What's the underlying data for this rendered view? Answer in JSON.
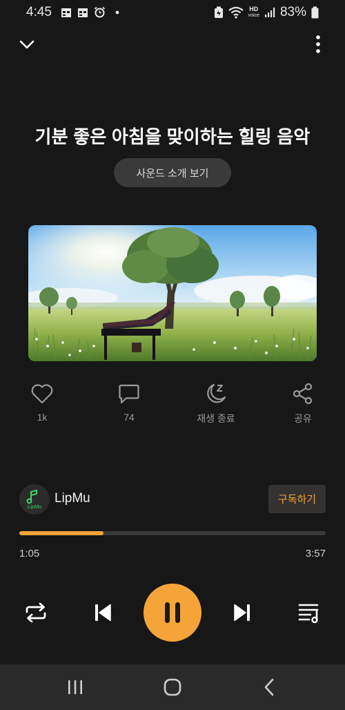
{
  "status_bar": {
    "time": "4:45",
    "battery": "83%",
    "hd_line1": "HD",
    "hd_line2": "voice",
    "icons": [
      "calendar-icon",
      "calendar-icon",
      "alarm-icon",
      "dot-icon",
      "battery-saver-icon",
      "wifi-icon",
      "signal-icon",
      "battery-icon"
    ]
  },
  "header": {
    "collapse_icon": "chevron-down-icon",
    "more_icon": "more-vertical-icon"
  },
  "track": {
    "title": "기분 좋은 아침을 맞이하는 힐링 음악",
    "sound_intro_label": "사운드 소개 보기",
    "artwork": "piano-meadow-artwork"
  },
  "actions": {
    "like_count": "1k",
    "comment_count": "74",
    "sleep_timer_label": "재생 종료",
    "share_label": "공유"
  },
  "channel": {
    "name": "LipMu",
    "logo_text": "LipMu",
    "subscribe_label": "구독하기"
  },
  "playback": {
    "current_time": "1:05",
    "total_time": "3:57",
    "progress_fraction": 0.274,
    "state": "playing"
  },
  "colors": {
    "background": "#171717",
    "accent": "#f5a43a",
    "subscribe_text": "#f5a037",
    "muted_text": "#9a9a9a"
  },
  "nav_bar": {
    "icons": [
      "recent-apps-icon",
      "home-icon",
      "back-icon"
    ]
  }
}
